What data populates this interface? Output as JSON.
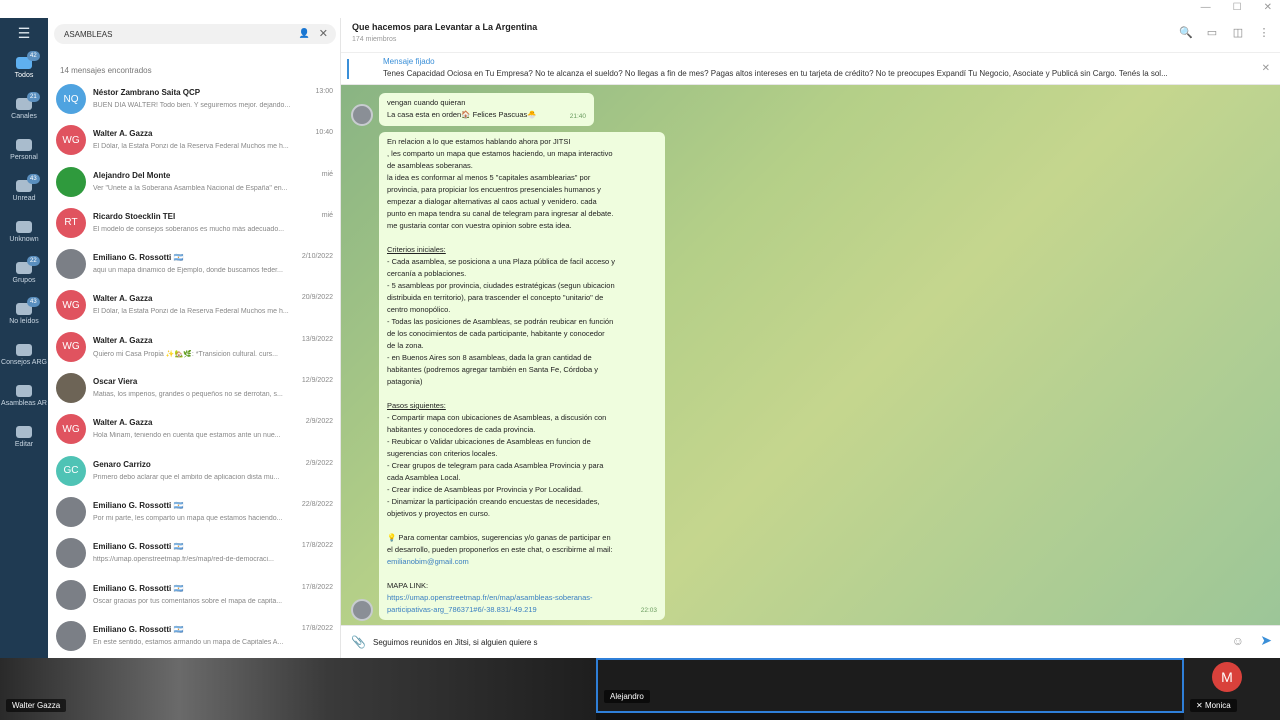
{
  "header": {
    "title": "Que hacemos para Levantar a La Argentina",
    "subtitle": "174 miembros"
  },
  "pinned": {
    "label": "Mensaje fijado",
    "text": "Tenes Capacidad Ociosa en Tu Empresa?   No te alcanza el sueldo? No llegas a fin de mes? Pagas altos intereses en tu tarjeta de crédito? No te preocupes Expandí Tu Negocio, Asociate  y Publicá sin Cargo. Tenés la sol..."
  },
  "search": {
    "value": "ASAMBLEAS",
    "results_label": "14 mensajes encontrados"
  },
  "folders": [
    {
      "label": "Todos",
      "badge": "42",
      "icon": "chat-bubbles-icon"
    },
    {
      "label": "Canales",
      "badge": "21",
      "icon": "megaphone-icon"
    },
    {
      "label": "Personal",
      "badge": "",
      "icon": "person-icon"
    },
    {
      "label": "Unread",
      "badge": "43",
      "icon": "unread-icon"
    },
    {
      "label": "Unknown",
      "badge": "",
      "icon": "unknown-user-icon"
    },
    {
      "label": "Grupos",
      "badge": "22",
      "icon": "group-icon"
    },
    {
      "label": "No leídos",
      "badge": "43",
      "icon": "unread-icon"
    },
    {
      "label": "Consejos ARG",
      "badge": "",
      "icon": "folder-icon"
    },
    {
      "label": "Asambleas AR",
      "badge": "",
      "icon": "folder-icon"
    },
    {
      "label": "Editar",
      "badge": "",
      "icon": "sliders-icon"
    }
  ],
  "results": [
    {
      "initials": "NQ",
      "color": "#4fa3e0",
      "name": "Néstor Zambrano Saita QCP",
      "date": "13:00",
      "preview": "BUEN DIA WALTER! Todo bien. Y seguiremos mejor. dejando..."
    },
    {
      "initials": "WG",
      "color": "#e0535f",
      "name": "Walter A. Gazza",
      "date": "10:40",
      "preview": "El Dólar, la Estafa Ponzi de la Reserva Federal   Muchos me h..."
    },
    {
      "initials": "",
      "color": "#2f9a3d",
      "name": "Alejandro Del Monte",
      "date": "mié",
      "preview": "Ver \"Unete a la Soberana Asamblea Nacional de España\" en..."
    },
    {
      "initials": "RT",
      "color": "#e0535f",
      "name": "Ricardo Stoecklin TEI",
      "date": "mié",
      "preview": "El modelo de consejos soberanos es mucho más adecuado..."
    },
    {
      "initials": "",
      "color": "#7b7f86",
      "name": "Emiliano G. Rossotti 🇦🇷",
      "date": "2/10/2022",
      "preview": "aqui un mapa dinamico de Ejemplo, donde buscamos feder..."
    },
    {
      "initials": "WG",
      "color": "#e0535f",
      "name": "Walter A. Gazza",
      "date": "20/9/2022",
      "preview": "El Dólar, la Estafa Ponzi de la Reserva Federal   Muchos me h..."
    },
    {
      "initials": "WG",
      "color": "#e0535f",
      "name": "Walter A. Gazza",
      "date": "13/9/2022",
      "preview": "Quiero mi Casa Propia ✨🏡🌿: *Transicion cultural. curs..."
    },
    {
      "initials": "",
      "color": "#6d6456",
      "name": "Oscar Viera",
      "date": "12/9/2022",
      "preview": "Matias, los imperios, grandes o pequeños no se derrotan, s..."
    },
    {
      "initials": "WG",
      "color": "#e0535f",
      "name": "Walter A. Gazza",
      "date": "2/9/2022",
      "preview": "Hola Miriam, teniendo en cuenta que estamos ante un nue..."
    },
    {
      "initials": "GC",
      "color": "#4fc3b5",
      "name": "Genaro Carrizo",
      "date": "2/9/2022",
      "preview": "Primero debo aclarar que el ambito de aplicacion dista mu..."
    },
    {
      "initials": "",
      "color": "#7b7f86",
      "name": "Emiliano G. Rossotti 🇦🇷",
      "date": "22/8/2022",
      "preview": "Por mi parte, les comparto un mapa que estamos haciendo..."
    },
    {
      "initials": "",
      "color": "#7b7f86",
      "name": "Emiliano G. Rossotti 🇦🇷",
      "date": "17/8/2022",
      "preview": "https://umap.openstreetmap.fr/es/map/red-de-democraci..."
    },
    {
      "initials": "",
      "color": "#7b7f86",
      "name": "Emiliano G. Rossotti 🇦🇷",
      "date": "17/8/2022",
      "preview": "Oscar gracias por tus comentarios sobre el mapa de capita..."
    },
    {
      "initials": "",
      "color": "#7b7f86",
      "name": "Emiliano G. Rossotti 🇦🇷",
      "date": "17/8/2022",
      "preview": "En este sentido, estamos armando un mapa de Capitales A..."
    }
  ],
  "messages": {
    "m1": {
      "lines": [
        "vengan cuando quieran",
        "La casa esta en orden🏠 Felices Pascuas🐣"
      ],
      "time": "21:40"
    },
    "m2": {
      "lines": [
        {
          "t": "En relacion a lo que estamos hablando ahora por JITSI",
          "s": ""
        },
        {
          "t": ", les comparto un mapa que estamos haciendo, un mapa interactivo",
          "s": ""
        },
        {
          "t": "de asambleas soberanas.",
          "s": ""
        },
        {
          "t": "la idea es conformar al menos 5 \"capitales asamblearias\" por",
          "s": ""
        },
        {
          "t": "provincia, para propiciar los encuentros presenciales humanos y",
          "s": ""
        },
        {
          "t": "empezar a dialogar alternativas al caos actual y venidero. cada",
          "s": ""
        },
        {
          "t": "punto en mapa tendra su canal de telegram para ingresar al debate.",
          "s": ""
        },
        {
          "t": "me gustaria contar con vuestra opinion sobre esta idea.",
          "s": ""
        },
        {
          "t": "",
          "s": ""
        },
        {
          "t": "Criterios iniciales:",
          "s": "u"
        },
        {
          "t": "- Cada asamblea, se posiciona a una Plaza pública de facil acceso y",
          "s": ""
        },
        {
          "t": "cercanía a poblaciones.",
          "s": ""
        },
        {
          "t": "- 5 asambleas por provincia, ciudades estratégicas (segun ubicacion",
          "s": ""
        },
        {
          "t": "distribuida en territorio), para trascender el concepto \"unitario\" de",
          "s": ""
        },
        {
          "t": "centro monopólico.",
          "s": ""
        },
        {
          "t": "- Todas las posiciones de Asambleas, se podrán reubicar en función",
          "s": ""
        },
        {
          "t": "de los conocimientos de cada participante, habitante y conocedor",
          "s": ""
        },
        {
          "t": "de la zona.",
          "s": ""
        },
        {
          "t": "- en Buenos Aires son 8 asambleas, dada la gran cantidad de",
          "s": ""
        },
        {
          "t": "habitantes (podremos agregar también  en Santa Fe, Córdoba y",
          "s": ""
        },
        {
          "t": "patagonia)",
          "s": ""
        },
        {
          "t": "",
          "s": ""
        },
        {
          "t": "Pasos siguientes:",
          "s": "u"
        },
        {
          "t": "- Compartir mapa con ubicaciones de Asambleas, a discusión con",
          "s": ""
        },
        {
          "t": "habitantes y conocedores de cada provincia.",
          "s": ""
        },
        {
          "t": "- Reubicar o Validar ubicaciones de Asambleas en funcion de",
          "s": ""
        },
        {
          "t": "sugerencias con criterios locales.",
          "s": ""
        },
        {
          "t": "- Crear grupos de telegram para cada Asamblea Provincia y para",
          "s": ""
        },
        {
          "t": "cada Asamblea Local.",
          "s": ""
        },
        {
          "t": "- Crear indice de Asambleas por Provincia y Por Localidad.",
          "s": ""
        },
        {
          "t": "- Dinamizar la participación creando encuestas de necesidades,",
          "s": ""
        },
        {
          "t": "objetivos y proyectos en curso.",
          "s": ""
        },
        {
          "t": "",
          "s": ""
        },
        {
          "t": "💡 Para comentar cambios, sugerencias y/o ganas de participar en",
          "s": ""
        },
        {
          "t": "el desarrollo, pueden proponerlos en este chat, o escribirme al mail:",
          "s": ""
        },
        {
          "t": "emilianobim@gmail.com",
          "s": "l"
        },
        {
          "t": "",
          "s": ""
        },
        {
          "t": "MAPA LINK:",
          "s": ""
        },
        {
          "t": "https://umap.openstreetmap.fr/en/map/asambleas-soberanas-",
          "s": "l"
        },
        {
          "t": "participativas-arg_786371#6/-38.831/-49.219",
          "s": "l"
        }
      ],
      "time": "22:03"
    }
  },
  "composer": {
    "value": "Seguimos reunidos en Jitsi, si alguien quiere s"
  },
  "video": {
    "tile1_name": "Walter Gazza",
    "tile2_name": "Alejandro",
    "tile3_name": "Monica",
    "tile3_initial": "M"
  }
}
